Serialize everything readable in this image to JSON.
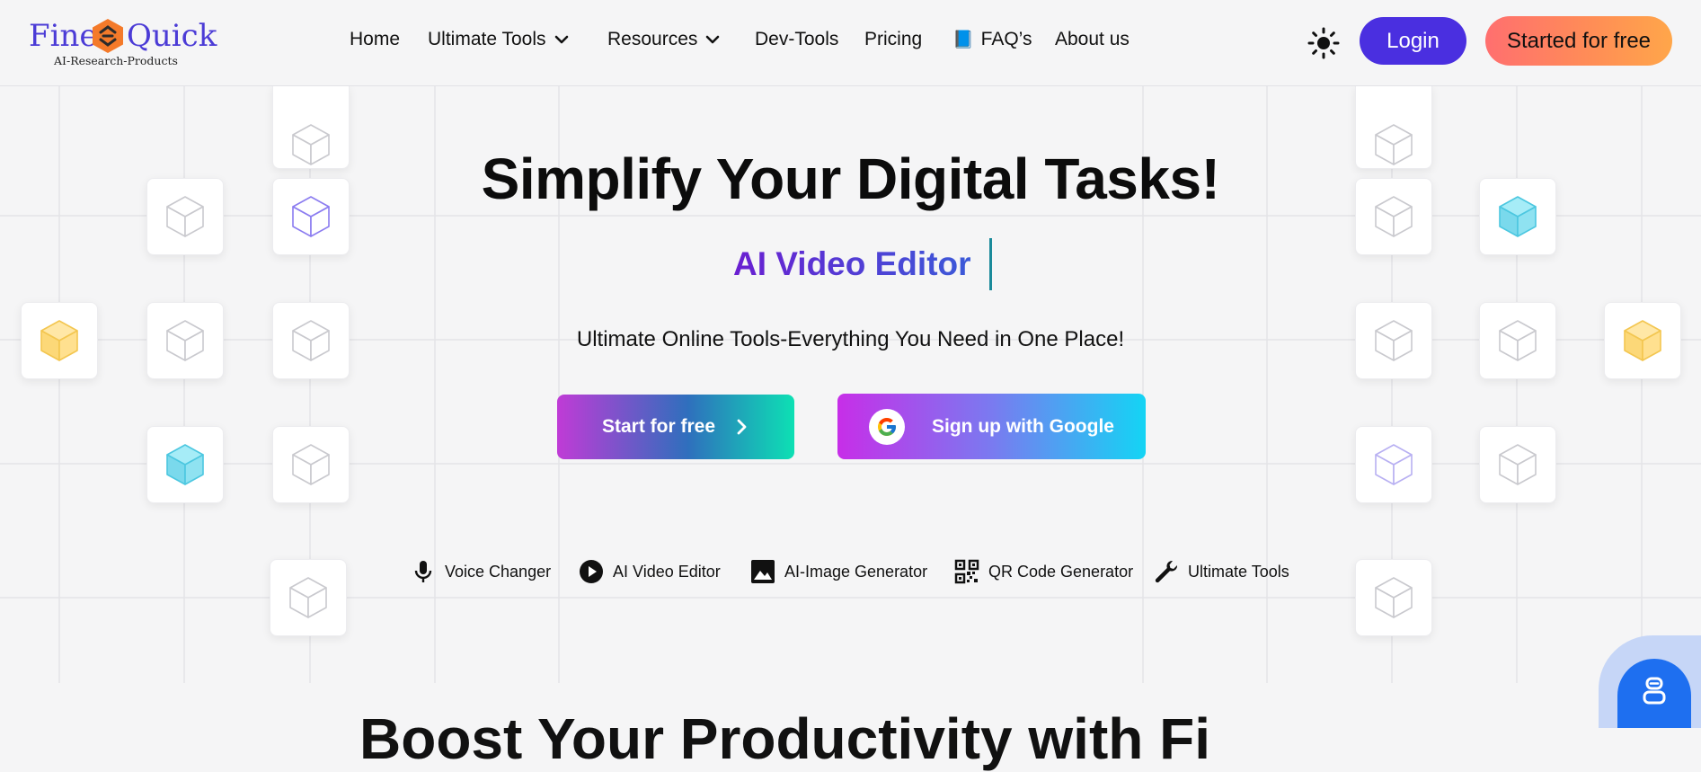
{
  "brand": {
    "name_part1": "Fine",
    "name_part2": "Quick",
    "tagline": "AI-Research-Products",
    "logo_icon": "hexagon-logo-icon",
    "color": "#4b3bd6"
  },
  "nav": {
    "items": [
      {
        "label": "Home",
        "dropdown": false
      },
      {
        "label": "Ultimate Tools",
        "dropdown": true
      },
      {
        "label": "Resources",
        "dropdown": true
      },
      {
        "label": "Dev-Tools",
        "dropdown": false
      },
      {
        "label": "Pricing",
        "dropdown": false
      },
      {
        "label": "FAQ’s",
        "icon": "📘",
        "dropdown": false
      },
      {
        "label": "About us",
        "dropdown": false
      }
    ],
    "theme_icon": "sun-icon",
    "login_label": "Login",
    "started_label": "Started for free",
    "accent": "#4a2fe0"
  },
  "hero": {
    "title": "Simplify Your Digital Tasks!",
    "typed_text": "AI Video Editor",
    "subtitle": "Ultimate Online Tools-Everything You Need in One Place!",
    "start_button": "Start for free",
    "google_button": "Sign up with Google"
  },
  "tools": [
    {
      "label": "Voice Changer",
      "icon": "microphone-icon"
    },
    {
      "label": "AI Video Editor",
      "icon": "play-circle-icon"
    },
    {
      "label": "AI-Image Generator",
      "icon": "image-icon"
    },
    {
      "label": "QR Code Generator",
      "icon": "qr-code-icon"
    },
    {
      "label": "Ultimate Tools",
      "icon": "wrench-icon"
    }
  ],
  "section": {
    "title_partial": "Boost Your Productivity with Fi"
  },
  "chat": {
    "icon": "chatbot-icon",
    "color": "#1e6ff0"
  }
}
